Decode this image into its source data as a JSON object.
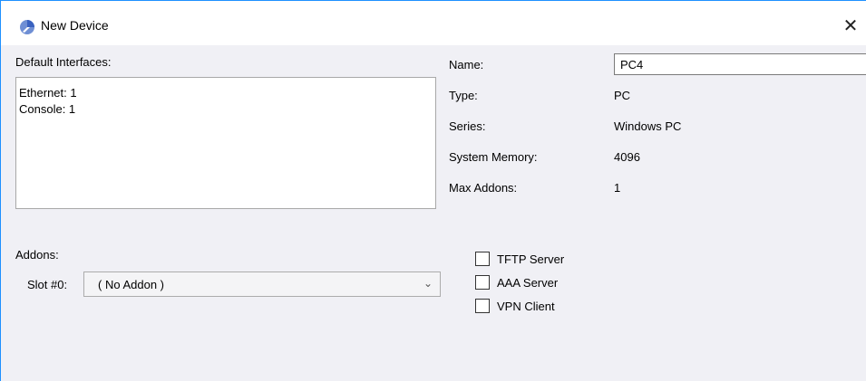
{
  "window": {
    "title": "New Device",
    "close_symbol": "✕",
    "icon": "app-logo-icon",
    "accent": "#1e90ff"
  },
  "interfaces": {
    "label": "Default Interfaces:",
    "items": [
      "Ethernet: 1",
      "Console: 1"
    ]
  },
  "addons": {
    "label": "Addons:",
    "slot_label": "Slot #0:",
    "slot_value": "( No Addon )"
  },
  "details": {
    "name_label": "Name:",
    "name_value": "PC4",
    "type_label": "Type:",
    "type_value": "PC",
    "series_label": "Series:",
    "series_value": "Windows PC",
    "memory_label": "System Memory:",
    "memory_value": "4096",
    "max_addons_label": "Max Addons:",
    "max_addons_value": "1"
  },
  "options": [
    {
      "label": "TFTP Server",
      "checked": false
    },
    {
      "label": "AAA Server",
      "checked": false
    },
    {
      "label": "VPN Client",
      "checked": false
    }
  ]
}
